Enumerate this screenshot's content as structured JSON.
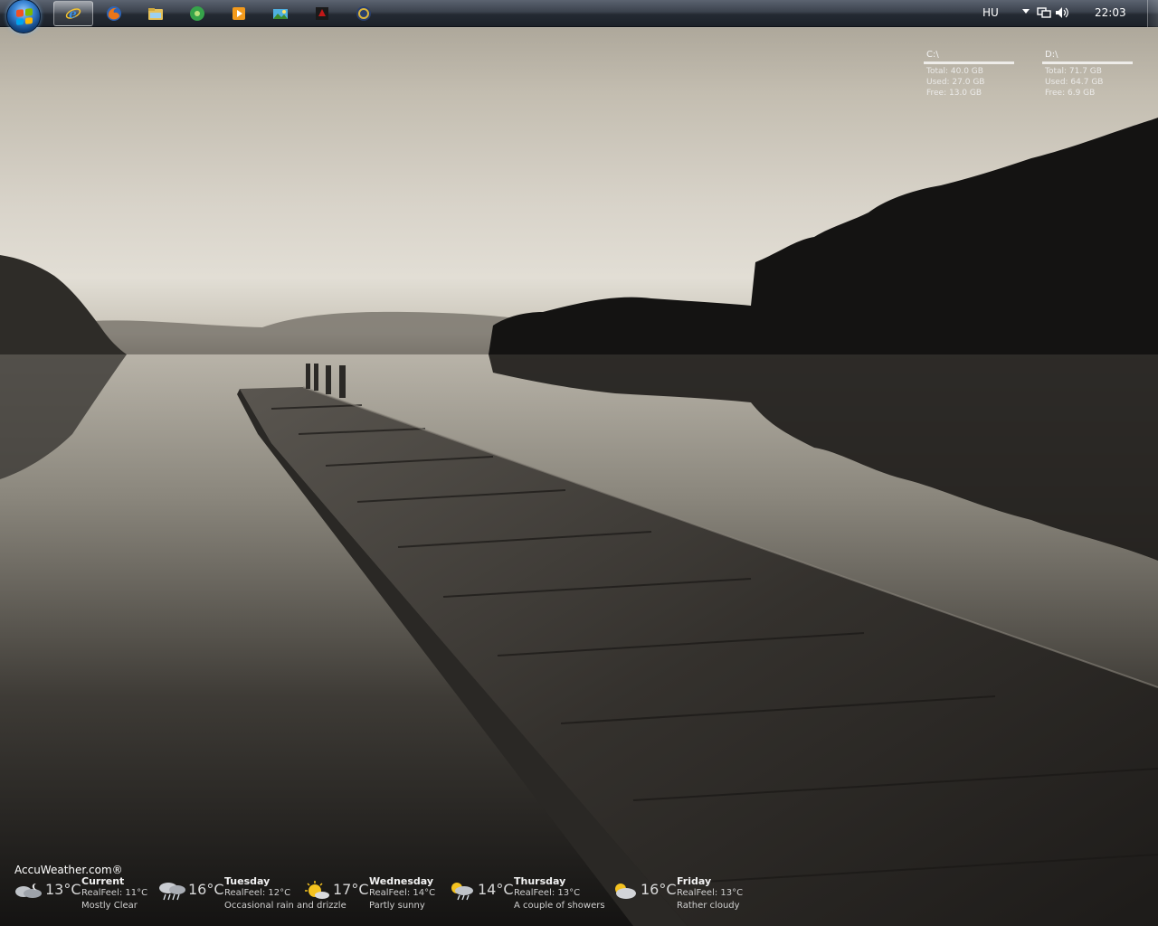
{
  "taskbar": {
    "start_button": "start-orb",
    "pinned": [
      {
        "name": "internet-explorer-icon",
        "color": "#3a8fe0",
        "active": true
      },
      {
        "name": "firefox-icon",
        "color": "#e8751a"
      },
      {
        "name": "windows-explorer-icon",
        "color": "#e5c15a"
      },
      {
        "name": "media-center-icon",
        "color": "#36a34a"
      },
      {
        "name": "media-player-icon",
        "color": "#f39a1c"
      },
      {
        "name": "photo-gallery-icon",
        "color": "#4fb0e0"
      },
      {
        "name": "red-app-icon",
        "color": "#c21818"
      },
      {
        "name": "gold-app-icon",
        "color": "#d9b43c"
      }
    ]
  },
  "tray": {
    "language": "HU",
    "clock": "22:03"
  },
  "drives": [
    {
      "title": "C:\\",
      "total": "Total: 40.0 GB",
      "used": "Used: 27.0 GB",
      "free": "Free: 13.0 GB"
    },
    {
      "title": "D:\\",
      "total": "Total: 71.7 GB",
      "used": "Used: 64.7 GB",
      "free": "Free: 6.9 GB"
    }
  ],
  "weather": {
    "brand": "AccuWeather.com®",
    "days": [
      {
        "temp": "13°C",
        "name": "Current",
        "realfeel": "RealFeel: 11°C",
        "desc": "Mostly Clear",
        "icon": "moon-cloud-icon"
      },
      {
        "temp": "16°C",
        "name": "Tuesday",
        "realfeel": "RealFeel: 12°C",
        "desc": "Occasional rain and drizzle",
        "icon": "rain-cloud-icon"
      },
      {
        "temp": "17°C",
        "name": "Wednesday",
        "realfeel": "RealFeel: 14°C",
        "desc": "Partly sunny",
        "icon": "partly-sunny-icon"
      },
      {
        "temp": "14°C",
        "name": "Thursday",
        "realfeel": "RealFeel: 13°C",
        "desc": "A couple of showers",
        "icon": "sun-shower-icon"
      },
      {
        "temp": "16°C",
        "name": "Friday",
        "realfeel": "RealFeel: 13°C",
        "desc": "Rather cloudy",
        "icon": "sun-cloud-icon"
      }
    ]
  }
}
